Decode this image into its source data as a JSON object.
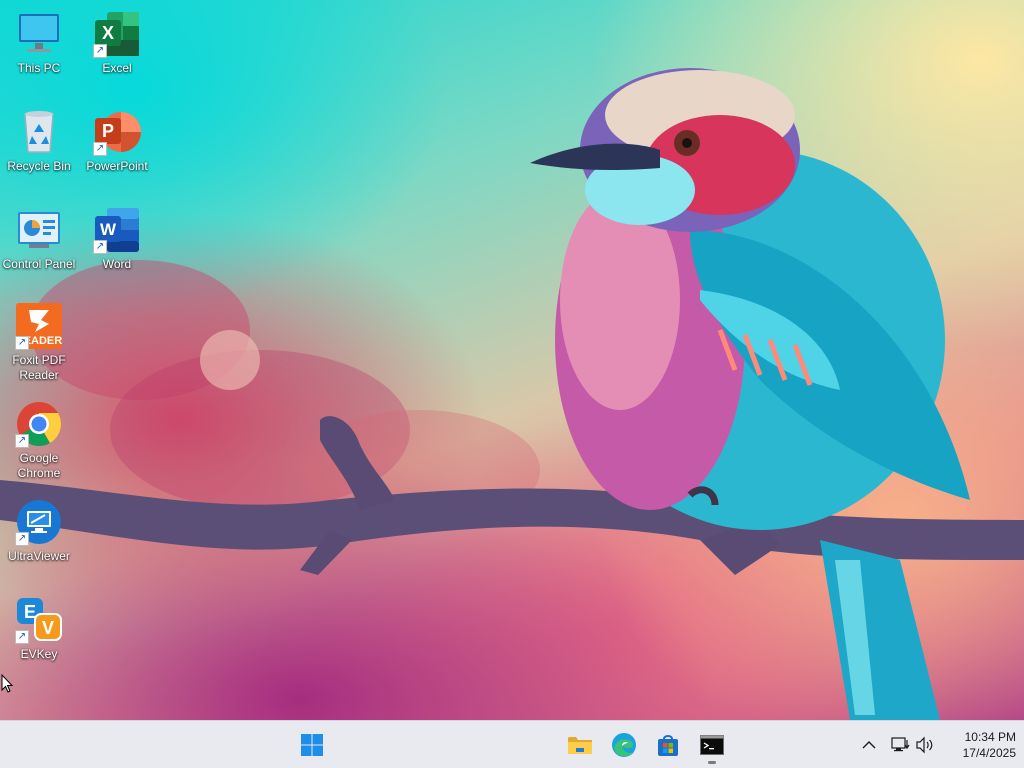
{
  "desktop": {
    "icons": [
      {
        "label": "This PC",
        "icon": "computer-icon"
      },
      {
        "label": "Excel",
        "icon": "excel-icon"
      },
      {
        "label": "Recycle Bin",
        "icon": "recycle-bin-icon"
      },
      {
        "label": "PowerPoint",
        "icon": "powerpoint-icon"
      },
      {
        "label": "Control Panel",
        "icon": "control-panel-icon"
      },
      {
        "label": "Word",
        "icon": "word-icon"
      },
      {
        "label": "Foxit PDF Reader",
        "icon": "foxit-reader-icon",
        "badge": "READER"
      },
      {
        "label": "Google Chrome",
        "icon": "chrome-icon"
      },
      {
        "label": "UltraViewer",
        "icon": "ultraviewer-icon"
      },
      {
        "label": "EVKey",
        "icon": "evkey-icon"
      }
    ]
  },
  "taskbar": {
    "pinned": [
      {
        "name": "start-button",
        "icon": "windows-logo-icon"
      },
      {
        "name": "file-explorer",
        "icon": "folder-icon"
      },
      {
        "name": "edge",
        "icon": "edge-icon"
      },
      {
        "name": "microsoft-store",
        "icon": "store-icon"
      },
      {
        "name": "command-prompt",
        "icon": "terminal-icon",
        "active": true
      }
    ],
    "tray": {
      "clock_time": "10:34 PM",
      "clock_date": "17/4/2025"
    }
  },
  "colors": {
    "taskbar_bg": "#e8eaef",
    "windows_blue": "#1e8fe8",
    "excel_green": "#107c41",
    "powerpoint_orange": "#d24726",
    "word_blue": "#185abd",
    "foxit_orange": "#f26b21"
  }
}
